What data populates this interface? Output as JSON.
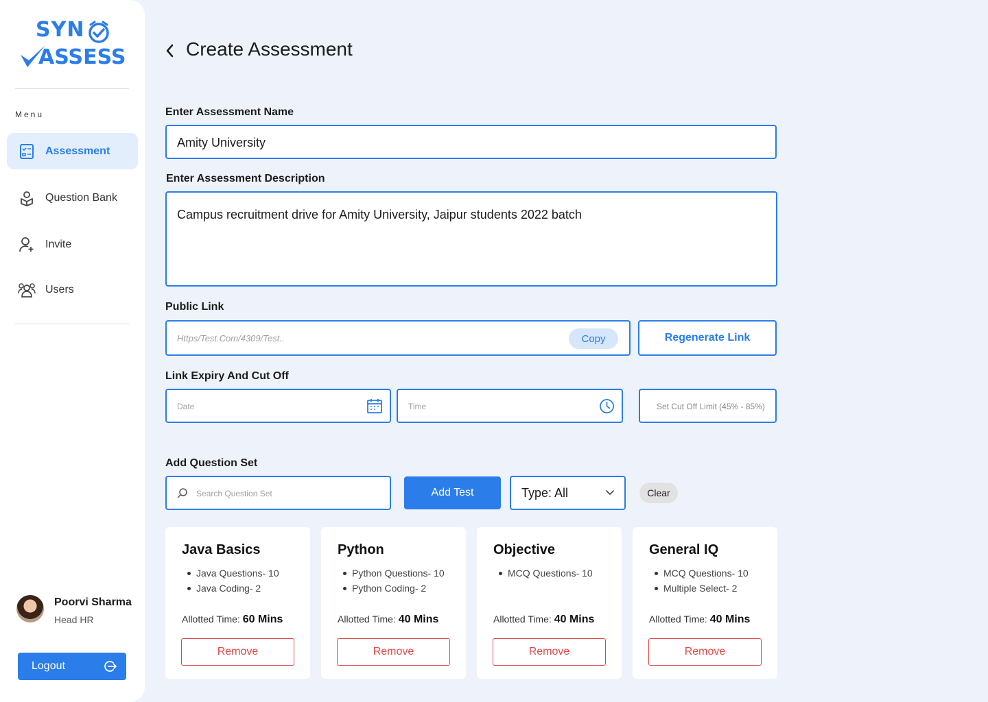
{
  "brand": {
    "line1": "SYN",
    "line2": "ASSESS",
    "color": "#2b7de9"
  },
  "sidebar": {
    "menu_label": "Menu",
    "items": [
      {
        "label": "Assessment",
        "icon": "checklist-icon",
        "active": true
      },
      {
        "label": "Question Bank",
        "icon": "question-bank-icon",
        "active": false
      },
      {
        "label": "Invite",
        "icon": "add-user-icon",
        "active": false
      },
      {
        "label": "Users",
        "icon": "users-icon",
        "active": false
      }
    ],
    "profile": {
      "name": "Poorvi Sharma",
      "role": "Head HR"
    },
    "logout_label": "Logout"
  },
  "page": {
    "title": "Create Assessment",
    "name_label": "Enter Assessment Name",
    "name_value": "Amity University",
    "desc_label": "Enter Assessment Description",
    "desc_value": "Campus recruitment drive for Amity University, Jaipur students 2022 batch",
    "public_link_label": "Public Link",
    "public_link_placeholder": "Https/Test.Com/4309/Test..",
    "copy_label": "Copy",
    "regenerate_label": "Regenerate Link",
    "expiry_label": "Link Expiry And Cut Off",
    "date_placeholder": "Date",
    "time_placeholder": "Time",
    "cutoff_placeholder": "Set Cut Off Limit (45% - 85%)",
    "question_set_label": "Add Question Set",
    "search_placeholder": "Search Question Set",
    "add_test_label": "Add Test",
    "type_value": "Type: All",
    "clear_label": "Clear"
  },
  "cards": [
    {
      "title": "Java Basics",
      "items": [
        "Java Questions- 10",
        "Java Coding- 2"
      ],
      "time_label": "Allotted Time:",
      "time_value": "60 Mins",
      "remove_label": "Remove"
    },
    {
      "title": "Python",
      "items": [
        "Python Questions- 10",
        "Python Coding- 2"
      ],
      "time_label": "Allotted Time:",
      "time_value": "40 Mins",
      "remove_label": "Remove"
    },
    {
      "title": "Objective",
      "items": [
        "MCQ Questions- 10"
      ],
      "time_label": "Allotted Time:",
      "time_value": "40 Mins",
      "remove_label": "Remove"
    },
    {
      "title": "General IQ",
      "items": [
        "MCQ Questions- 10",
        "Multiple Select- 2"
      ],
      "time_label": "Allotted Time:",
      "time_value": "40 Mins",
      "remove_label": "Remove"
    }
  ],
  "colors": {
    "accent": "#2b7de9",
    "danger": "#e04848",
    "background": "#eef3fb"
  }
}
